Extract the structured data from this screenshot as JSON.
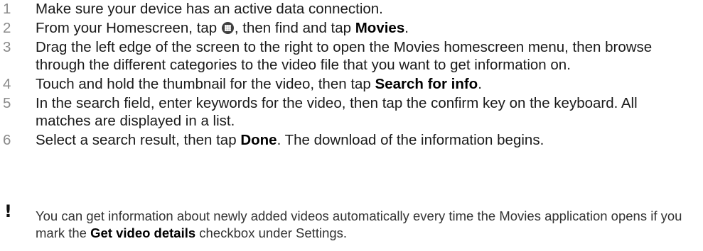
{
  "steps": [
    {
      "num": "1",
      "parts": [
        {
          "t": "Make sure your device has an active data connection."
        }
      ]
    },
    {
      "num": "2",
      "parts": [
        {
          "t": "From your Homescreen, tap "
        },
        {
          "icon": "apps-icon"
        },
        {
          "t": ", then find and tap "
        },
        {
          "b": "Movies"
        },
        {
          "t": "."
        }
      ]
    },
    {
      "num": "3",
      "parts": [
        {
          "t": "Drag the left edge of the screen to the right to open the Movies homescreen menu, then browse through the different categories to the video file that you want to get information on."
        }
      ]
    },
    {
      "num": "4",
      "parts": [
        {
          "t": "Touch and hold the thumbnail for the video, then tap "
        },
        {
          "b": "Search for info"
        },
        {
          "t": "."
        }
      ]
    },
    {
      "num": "5",
      "parts": [
        {
          "t": "In the search field, enter keywords for the video, then tap the confirm key on the keyboard. All matches are displayed in a list."
        }
      ]
    },
    {
      "num": "6",
      "parts": [
        {
          "t": "Select a search result, then tap "
        },
        {
          "b": "Done"
        },
        {
          "t": ". The download of the information begins."
        }
      ]
    }
  ],
  "note": {
    "icon": "exclamation-icon",
    "symbol": "!",
    "parts": [
      {
        "t": "You can get information about newly added videos automatically every time the Movies application opens if you mark the "
      },
      {
        "b": "Get video details"
      },
      {
        "t": " checkbox under Settings."
      }
    ]
  }
}
